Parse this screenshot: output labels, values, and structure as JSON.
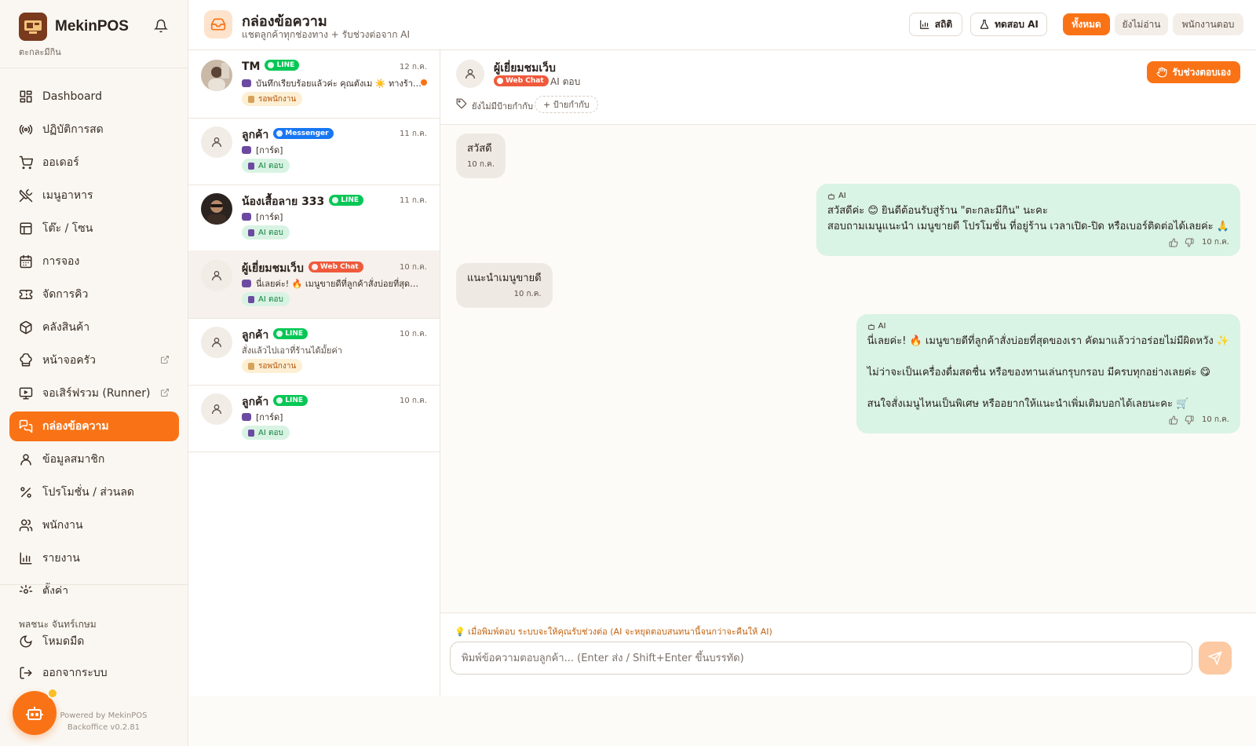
{
  "brand": {
    "name": "MekinPOS",
    "subtitle": "ตะกละมีกิน"
  },
  "nav": [
    {
      "label": "Dashboard",
      "icon": "dashboard-icon"
    },
    {
      "label": "ปฏิบัติการสด",
      "icon": "live-icon"
    },
    {
      "label": "ออเดอร์",
      "icon": "cart-icon"
    },
    {
      "label": "เมนูอาหาร",
      "icon": "utensils-icon"
    },
    {
      "label": "โต๊ะ / โซน",
      "icon": "table-icon"
    },
    {
      "label": "การจอง",
      "icon": "calendar-icon"
    },
    {
      "label": "จัดการคิว",
      "icon": "ticket-icon"
    },
    {
      "label": "คลังสินค้า",
      "icon": "box-icon"
    },
    {
      "label": "หน้าจอครัว",
      "icon": "chef-hat-icon",
      "external": true
    },
    {
      "label": "จอเสิร์ฟรวม (Runner)",
      "icon": "monitor-icon",
      "external": true
    },
    {
      "label": "กล่องข้อความ",
      "icon": "chat-icon",
      "active": true
    },
    {
      "label": "ข้อมูลสมาชิก",
      "icon": "user-icon"
    },
    {
      "label": "โปรโมชั่น / ส่วนลด",
      "icon": "percent-icon"
    },
    {
      "label": "พนักงาน",
      "icon": "users-icon"
    },
    {
      "label": "รายงาน",
      "icon": "bar-chart-icon"
    },
    {
      "label": "ตั้งค่า",
      "icon": "settings-icon"
    }
  ],
  "user": {
    "name": "พลชนะ จันทร์เกษม"
  },
  "bottom": {
    "dark_mode": "โหมดมืด",
    "logout": "ออกจากระบบ"
  },
  "powered": {
    "line1": "Powered by MekinPOS",
    "line2": "Backoffice v0.2.81"
  },
  "header": {
    "title": "กล่องข้อความ",
    "subtitle": "แชตลูกค้าทุกช่องทาง + รับช่วงต่อจาก AI",
    "stats_label": "สถิติ",
    "test_ai_label": "ทดสอบ AI",
    "filters": [
      "ทั้งหมด",
      "ยังไม่อ่าน",
      "พนักงานตอบ"
    ]
  },
  "conversations": [
    {
      "name": "TM",
      "channel": "LINE",
      "time": "12 ก.ค.",
      "preview": "บันทึกเรียบร้อยแล้วค่ะ คุณตังเม ☀️ ทางร้านจะเตรียมไว้ให้",
      "bot": true,
      "status": "รอพนักงาน",
      "status_type": "wait",
      "unread": true,
      "photo": true
    },
    {
      "name": "ลูกค้า",
      "channel": "Messenger",
      "time": "11 ก.ค.",
      "preview": "[การ์ด]",
      "bot": true,
      "status": "AI ตอบ",
      "status_type": "ai"
    },
    {
      "name": "น้องเสื้อลาย 333",
      "channel": "LINE",
      "time": "11 ก.ค.",
      "preview": "[การ์ด]",
      "bot": true,
      "status": "AI ตอบ",
      "status_type": "ai",
      "photo": true
    },
    {
      "name": "ผู้เยี่ยมชมเว็บ",
      "channel": "Web Chat",
      "time": "10 ก.ค.",
      "preview": "นี่เลยค่ะ! 🔥 เมนูขายดีที่ลูกค้าสั่งบ่อยที่สุดของเรา",
      "bot": true,
      "status": "AI ตอบ",
      "status_type": "ai",
      "selected": true
    },
    {
      "name": "ลูกค้า",
      "channel": "LINE",
      "time": "10 ก.ค.",
      "preview": "สั่งแล้วไปเอาที่ร้านได้มั้ยค่า",
      "bot": false,
      "status": "รอพนักงาน",
      "status_type": "wait"
    },
    {
      "name": "ลูกค้า",
      "channel": "LINE",
      "time": "10 ก.ค.",
      "preview": "[การ์ด]",
      "bot": true,
      "status": "AI ตอบ",
      "status_type": "ai"
    }
  ],
  "channel_colors": {
    "LINE": "#06c755",
    "Messenger": "#1877f2",
    "Web Chat": "#ef5a3c"
  },
  "chat": {
    "name": "ผู้เยี่ยมชมเว็บ",
    "channel": "Web Chat",
    "mode": "AI ตอบ",
    "takeover_label": "รับช่วงตอบเอง",
    "no_tag": "ยังไม่มีป้ายกำกับ",
    "add_tag": "+ ป้ายกำกับ",
    "messages": [
      {
        "side": "in",
        "text": "สวัสดี",
        "time": "10 ก.ค."
      },
      {
        "side": "out",
        "ai_label": "AI",
        "text": "สวัสดีค่ะ 😊 ยินดีต้อนรับสู่ร้าน \"ตะกละมีกิน\" นะคะ\nสอบถามเมนูแนะนำ เมนูขายดี โปรโมชั่น ที่อยู่ร้าน เวลาเปิด-ปิด หรือเบอร์ติดต่อได้เลยค่ะ 🙏",
        "time": "10 ก.ค."
      },
      {
        "side": "in",
        "text": "แนะนำเมนูขายดี",
        "time": "10 ก.ค."
      },
      {
        "side": "out",
        "ai_label": "AI",
        "text": "นี่เลยค่ะ! 🔥 เมนูขายดีที่ลูกค้าสั่งบ่อยที่สุดของเรา คัดมาแล้วว่าอร่อยไม่มีผิดหวัง ✨\n\nไม่ว่าจะเป็นเครื่องดื่มสดชื่น หรือของทานเล่นกรุบกรอบ มีครบทุกอย่างเลยค่ะ 😋\n\nสนใจสั่งเมนูไหนเป็นพิเศษ หรืออยากให้แนะนำเพิ่มเติมบอกได้เลยนะคะ 🛒",
        "time": "10 ก.ค."
      }
    ],
    "hint": "💡 เมื่อพิมพ์ตอบ ระบบจะให้คุณรับช่วงต่อ (AI จะหยุดตอบสนทนานี้จนกว่าจะคืนให้ AI)",
    "input_placeholder": "พิมพ์ข้อความตอบลูกค้า... (Enter ส่ง / Shift+Enter ขึ้นบรรทัด)"
  },
  "colors": {
    "accent": "#f97316",
    "ai_bubble": "#d9f3e4",
    "user_bubble": "#efe9e3"
  }
}
